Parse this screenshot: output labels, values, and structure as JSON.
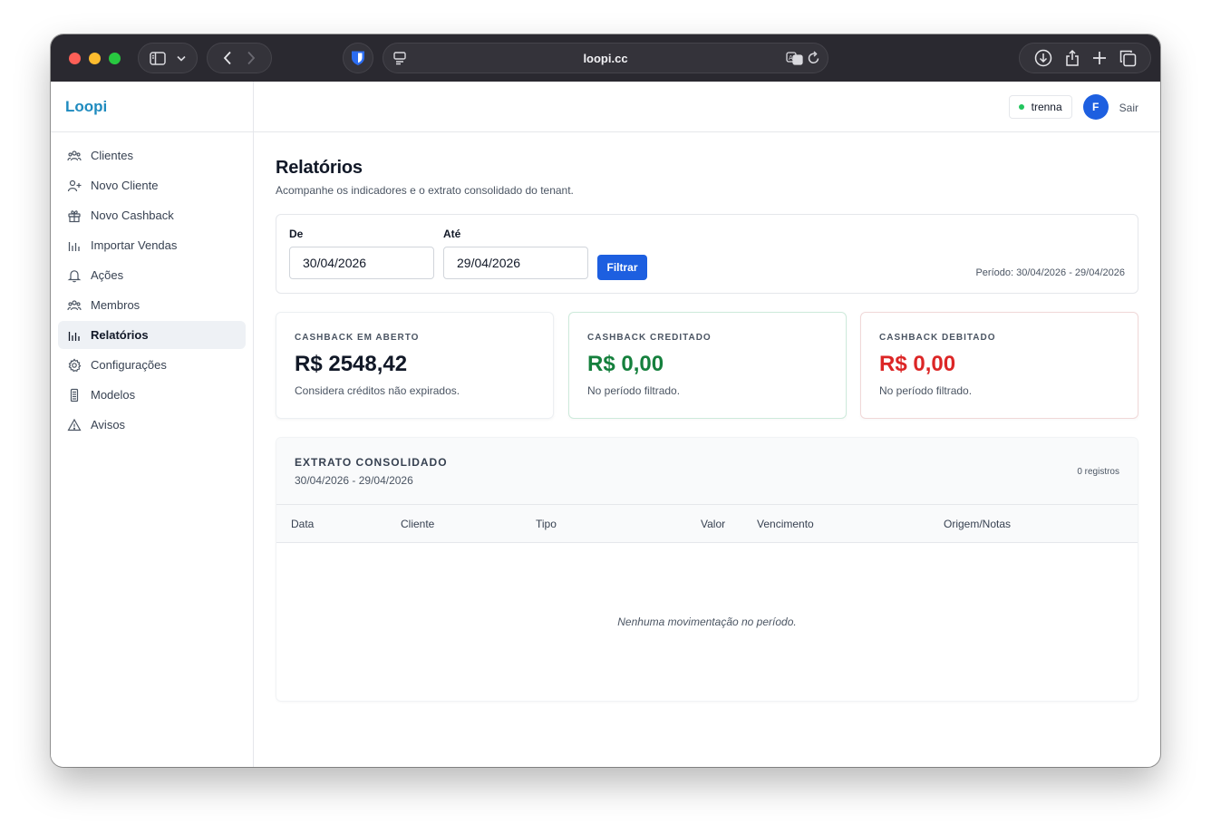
{
  "browser": {
    "url": "loopi.cc"
  },
  "app": {
    "brand": "Loopi"
  },
  "sidebar": {
    "items": [
      {
        "label": "Clientes",
        "icon": "users-icon"
      },
      {
        "label": "Novo Cliente",
        "icon": "user-plus-icon"
      },
      {
        "label": "Novo Cashback",
        "icon": "gift-icon"
      },
      {
        "label": "Importar Vendas",
        "icon": "bar-chart-icon"
      },
      {
        "label": "Ações",
        "icon": "bell-icon"
      },
      {
        "label": "Membros",
        "icon": "users-icon"
      },
      {
        "label": "Relatórios",
        "icon": "bar-chart-icon",
        "active": true
      },
      {
        "label": "Configurações",
        "icon": "gear-icon"
      },
      {
        "label": "Modelos",
        "icon": "document-icon"
      },
      {
        "label": "Avisos",
        "icon": "warning-icon"
      }
    ]
  },
  "header": {
    "tenant": "trenna",
    "tenant_status_color": "#22c55e",
    "avatar_initial": "F",
    "logout_label": "Sair"
  },
  "page": {
    "title": "Relatórios",
    "subtitle": "Acompanhe os indicadores e o extrato consolidado do tenant."
  },
  "filter": {
    "from_label": "De",
    "from_value": "30/04/2026",
    "to_label": "Até",
    "to_value": "29/04/2026",
    "button_label": "Filtrar",
    "period_text": "Período: 30/04/2026 - 29/04/2026"
  },
  "stats": [
    {
      "label": "CASHBACK EM ABERTO",
      "value": "R$ 2548,42",
      "note": "Considera créditos não expirados.",
      "color": "#111827"
    },
    {
      "label": "CASHBACK CREDITADO",
      "value": "R$ 0,00",
      "note": "No período filtrado.",
      "color": "#15803d"
    },
    {
      "label": "CASHBACK DEBITADO",
      "value": "R$ 0,00",
      "note": "No período filtrado.",
      "color": "#dc2626"
    }
  ],
  "statement": {
    "title": "EXTRATO CONSOLIDADO",
    "range": "30/04/2026 - 29/04/2026",
    "count": "0 registros",
    "columns": [
      "Data",
      "Cliente",
      "Tipo",
      "Valor",
      "Vencimento",
      "Origem/Notas"
    ],
    "empty_message": "Nenhuma movimentação no período."
  },
  "colors": {
    "brand": "#1f8bbf",
    "primary": "#1d5fe0"
  }
}
